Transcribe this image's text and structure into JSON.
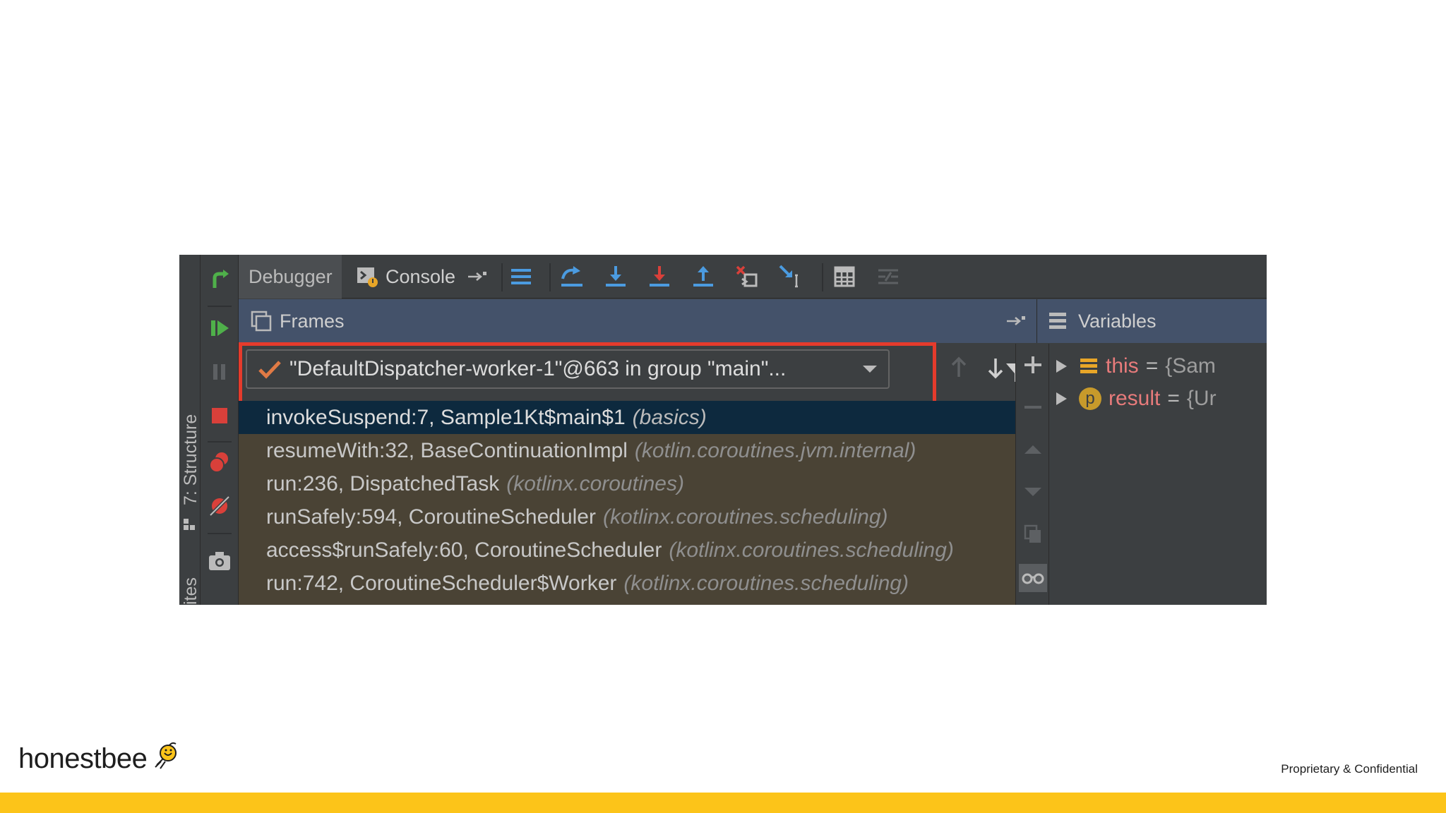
{
  "debugger": {
    "side_labels": {
      "structure": "7: Structure",
      "favorites": "ites"
    },
    "toolbar": {
      "debugger_tab": "Debugger",
      "console_tab": "Console"
    },
    "frames": {
      "header": "Frames",
      "thread": "\"DefaultDispatcher-worker-1\"@663 in group \"main\"...",
      "items": [
        {
          "method": "invokeSuspend:7, Sample1Kt$main$1",
          "pkg": "(basics)"
        },
        {
          "method": "resumeWith:32, BaseContinuationImpl",
          "pkg": "(kotlin.coroutines.jvm.internal)"
        },
        {
          "method": "run:236, DispatchedTask",
          "pkg": "(kotlinx.coroutines)"
        },
        {
          "method": "runSafely:594, CoroutineScheduler",
          "pkg": "(kotlinx.coroutines.scheduling)"
        },
        {
          "method": "access$runSafely:60, CoroutineScheduler",
          "pkg": "(kotlinx.coroutines.scheduling)"
        },
        {
          "method": "run:742, CoroutineScheduler$Worker",
          "pkg": "(kotlinx.coroutines.scheduling)"
        }
      ]
    },
    "variables": {
      "header": "Variables",
      "items": [
        {
          "name": "this",
          "eq": "=",
          "value": "{Sam"
        },
        {
          "name": "result",
          "eq": "=",
          "value": "{Ur",
          "badge": "p"
        }
      ]
    }
  },
  "footer": {
    "brand": "honestbee",
    "note": "Proprietary & Confidential"
  },
  "colors": {
    "highlight": "#e53b2c",
    "brand_yellow": "#fcc419",
    "selected_row": "#0d293e"
  }
}
